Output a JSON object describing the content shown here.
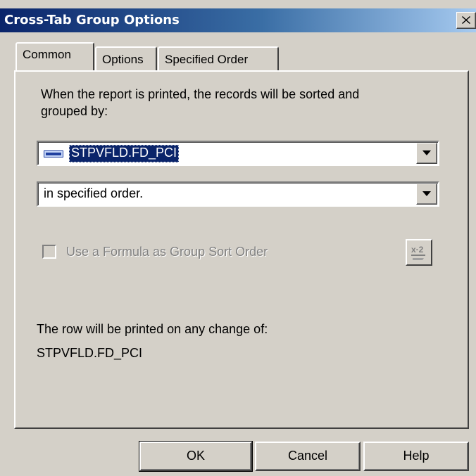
{
  "window": {
    "title": "Cross-Tab Group Options"
  },
  "tabs": [
    {
      "label": "Common",
      "active": true
    },
    {
      "label": "Options",
      "active": false
    },
    {
      "label": "Specified Order",
      "active": false
    }
  ],
  "common": {
    "sort_label_line1": "When the report is printed, the records will be sorted and",
    "sort_label_line2": "grouped by:",
    "group_field": {
      "value": "STPVFLD.FD_PCI",
      "icon": "database-field-icon"
    },
    "sort_order": {
      "value": "in specified order."
    },
    "formula_checkbox": {
      "label": "Use a Formula as Group Sort Order",
      "checked": false,
      "enabled": false
    },
    "formula_button_icon": "formula-x2-icon",
    "change_label": "The row will be printed on any change of:",
    "change_field": "STPVFLD.FD_PCI"
  },
  "buttons": {
    "ok": "OK",
    "cancel": "Cancel",
    "help": "Help"
  },
  "colors": {
    "titlebar_start": "#0a246a",
    "titlebar_end": "#a6caf0",
    "face": "#d4d0c8",
    "selection": "#0a246a"
  }
}
